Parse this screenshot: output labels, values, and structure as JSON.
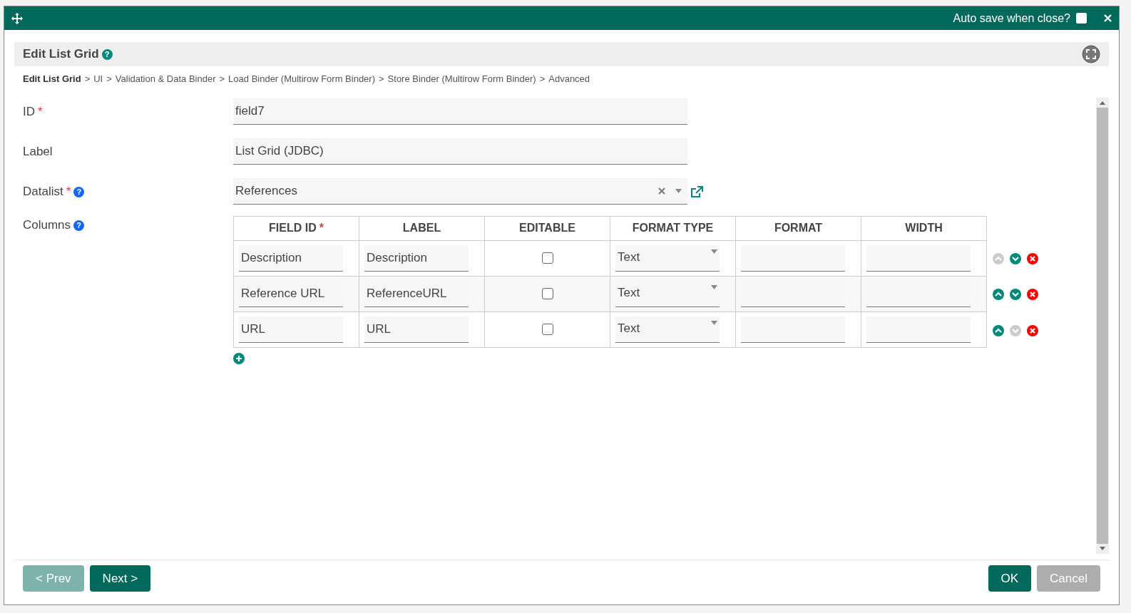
{
  "window": {
    "auto_save": {
      "label": "Auto save when close?",
      "checked": false
    }
  },
  "panel": {
    "title": "Edit List Grid",
    "help_icon": "?"
  },
  "breadcrumb": [
    {
      "label": "Edit List Grid",
      "selected": true
    },
    {
      "separator": ">",
      "label": "UI",
      "selected": false
    },
    {
      "separator": ">",
      "label": "Validation & Data Binder",
      "selected": false
    },
    {
      "separator": ">",
      "label": "Load Binder (Multirow Form Binder)",
      "selected": false
    },
    {
      "separator": ">",
      "label": "Store Binder (Multirow Form Binder)",
      "selected": false
    },
    {
      "separator": ">",
      "label": "Advanced",
      "selected": false
    }
  ],
  "fields": [
    {
      "kind": "text",
      "label": "ID",
      "required_mark": "*",
      "value": "field7"
    },
    {
      "kind": "text",
      "label": "Label",
      "value": "List Grid (JDBC)"
    },
    {
      "kind": "select",
      "label": "Datalist",
      "required_mark": "*",
      "help_icon": "?",
      "value": "References"
    }
  ],
  "columns": {
    "label": "Columns",
    "help_icon": "?",
    "headers": [
      {
        "label": "FIELD ID",
        "required_mark": "*"
      },
      {
        "label": "LABEL"
      },
      {
        "label": "EDITABLE"
      },
      {
        "label": "FORMAT TYPE"
      },
      {
        "label": "FORMAT"
      },
      {
        "label": "WIDTH"
      }
    ],
    "rows": [
      {
        "field_id": "Description",
        "label": "Description",
        "editable": false,
        "format_type": "Text",
        "up_disabled": true,
        "down_disabled": false
      },
      {
        "field_id": "Reference URL",
        "label": "ReferenceURL",
        "editable": false,
        "format_type": "Text",
        "up_disabled": false,
        "down_disabled": false
      },
      {
        "field_id": "URL",
        "label": "URL",
        "editable": false,
        "format_type": "Text",
        "up_disabled": false,
        "down_disabled": true
      }
    ]
  },
  "footer": {
    "buttons": [
      {
        "kind": "prev",
        "label": "< Prev",
        "disabled": true
      },
      {
        "kind": "next",
        "label": "Next >",
        "disabled": false
      },
      {
        "kind": "ok",
        "label": "OK",
        "disabled": false
      },
      {
        "kind": "cancel",
        "label": "Cancel",
        "disabled": true
      }
    ]
  }
}
